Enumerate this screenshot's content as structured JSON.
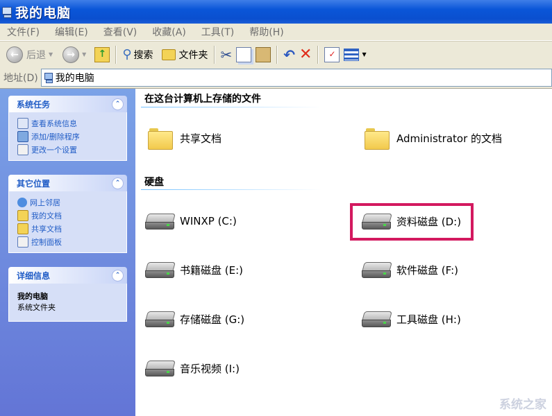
{
  "window": {
    "title": "我的电脑"
  },
  "menu": [
    "文件(F)",
    "编辑(E)",
    "查看(V)",
    "收藏(A)",
    "工具(T)",
    "帮助(H)"
  ],
  "toolbar": {
    "back": "后退",
    "search": "搜索",
    "folders": "文件夹"
  },
  "address": {
    "label": "地址(D)",
    "value": "我的电脑"
  },
  "sidebar": {
    "system_tasks": {
      "title": "系统任务",
      "items": [
        "查看系统信息",
        "添加/删除程序",
        "更改一个设置"
      ]
    },
    "other_places": {
      "title": "其它位置",
      "items": [
        "网上邻居",
        "我的文档",
        "共享文档",
        "控制面板"
      ]
    },
    "details": {
      "title": "详细信息",
      "name": "我的电脑",
      "desc": "系统文件夹"
    }
  },
  "main": {
    "stored_files": {
      "title": "在这台计算机上存储的文件",
      "items": [
        "共享文档",
        "Administrator 的文档"
      ]
    },
    "hard_drives": {
      "title": "硬盘",
      "items": [
        "WINXP (C:)",
        "资料磁盘 (D:)",
        "书籍磁盘 (E:)",
        "软件磁盘 (F:)",
        "存储磁盘 (G:)",
        "工具磁盘 (H:)",
        "音乐视频 (I:)"
      ]
    },
    "highlighted_item": "资料磁盘 (D:)"
  },
  "watermark": "系统之家",
  "colors": {
    "titlebar": "#0a56d8",
    "taskpane": "#6f8ee0",
    "highlight": "#d3195f",
    "link": "#215dc6"
  }
}
